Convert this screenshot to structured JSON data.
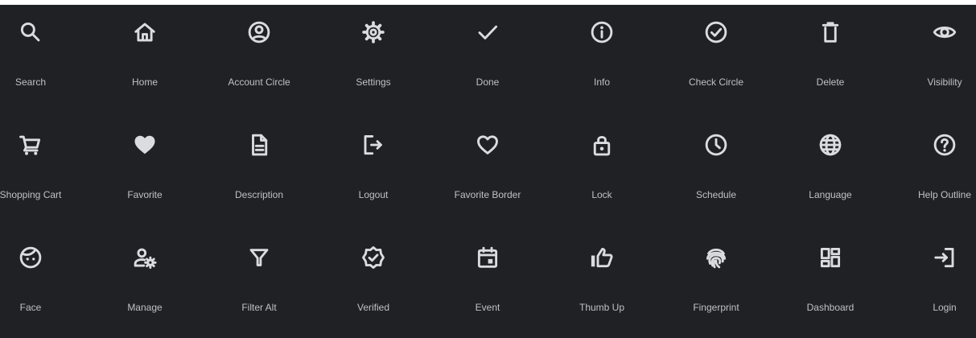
{
  "colors": {
    "page_background": "#ffffff",
    "panel_background": "#202124",
    "icon": "#dadce0",
    "label": "#bdc1c6"
  },
  "icons": [
    {
      "label": "Search",
      "icon": "search-icon"
    },
    {
      "label": "Home",
      "icon": "home-icon"
    },
    {
      "label": "Account Circle",
      "icon": "account-circle-icon"
    },
    {
      "label": "Settings",
      "icon": "settings-icon"
    },
    {
      "label": "Done",
      "icon": "done-icon"
    },
    {
      "label": "Info",
      "icon": "info-icon"
    },
    {
      "label": "Check Circle",
      "icon": "check-circle-icon"
    },
    {
      "label": "Delete",
      "icon": "delete-icon"
    },
    {
      "label": "Visibility",
      "icon": "visibility-icon"
    },
    {
      "label": "Shopping Cart",
      "icon": "shopping-cart-icon"
    },
    {
      "label": "Favorite",
      "icon": "favorite-icon"
    },
    {
      "label": "Description",
      "icon": "description-icon"
    },
    {
      "label": "Logout",
      "icon": "logout-icon"
    },
    {
      "label": "Favorite Border",
      "icon": "favorite-border-icon"
    },
    {
      "label": "Lock",
      "icon": "lock-icon"
    },
    {
      "label": "Schedule",
      "icon": "schedule-icon"
    },
    {
      "label": "Language",
      "icon": "language-icon"
    },
    {
      "label": "Help Outline",
      "icon": "help-outline-icon"
    },
    {
      "label": "Face",
      "icon": "face-icon"
    },
    {
      "label": "Manage",
      "icon": "manage-icon"
    },
    {
      "label": "Filter Alt",
      "icon": "filter-alt-icon"
    },
    {
      "label": "Verified",
      "icon": "verified-icon"
    },
    {
      "label": "Event",
      "icon": "event-icon"
    },
    {
      "label": "Thumb Up",
      "icon": "thumb-up-icon"
    },
    {
      "label": "Fingerprint",
      "icon": "fingerprint-icon"
    },
    {
      "label": "Dashboard",
      "icon": "dashboard-icon"
    },
    {
      "label": "Login",
      "icon": "login-icon"
    }
  ]
}
